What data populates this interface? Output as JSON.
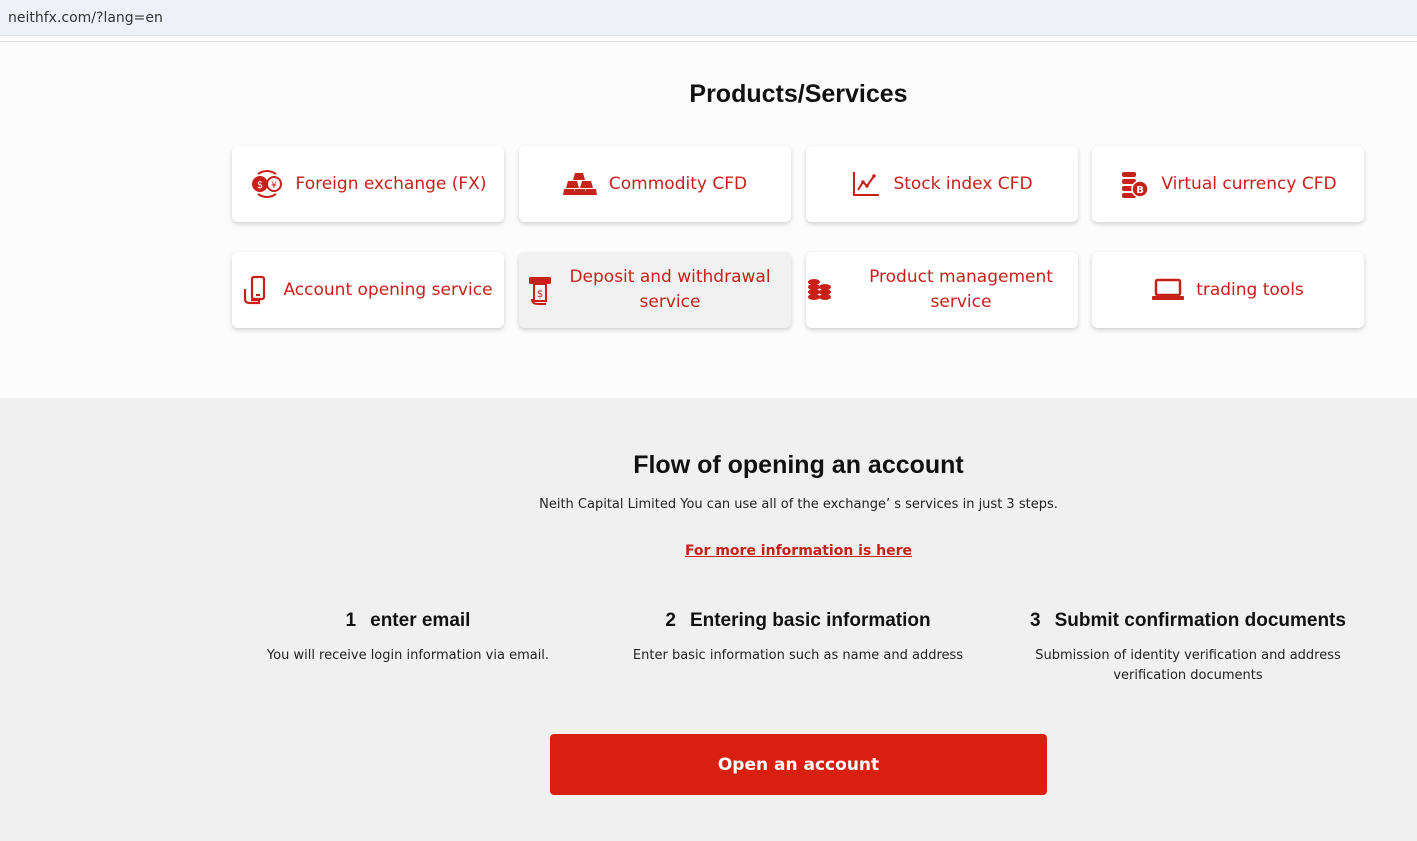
{
  "browser": {
    "url": "neithfx.com/?lang=en"
  },
  "products": {
    "title": "Products/Services",
    "cards": [
      {
        "label": "Foreign exchange (FX)",
        "icon": "currency-exchange-icon"
      },
      {
        "label": "Commodity CFD",
        "icon": "gold-bars-icon"
      },
      {
        "label": "Stock index CFD",
        "icon": "line-chart-icon"
      },
      {
        "label": "Virtual currency CFD",
        "icon": "bitcoin-coins-icon"
      },
      {
        "label": "Account opening service",
        "icon": "mobile-hand-icon"
      },
      {
        "label": "Deposit and withdrawal service",
        "icon": "atm-icon"
      },
      {
        "label": "Product management service",
        "icon": "coin-stack-icon"
      },
      {
        "label": "trading tools",
        "icon": "laptop-icon"
      }
    ]
  },
  "flow": {
    "title": "Flow of opening an account",
    "subtitle": "Neith Capital Limited You can use all of the exchange’ s services in just 3 steps.",
    "link": "For more information is here",
    "steps": [
      {
        "num": "1",
        "title": "enter email",
        "desc": "You will receive login information via email."
      },
      {
        "num": "2",
        "title": "Entering basic information",
        "desc": "Enter basic information such as name and address"
      },
      {
        "num": "3",
        "title": "Submit confirmation documents",
        "desc": "Submission of identity verification and address verification documents"
      }
    ],
    "button": "Open an account"
  },
  "colors": {
    "accent": "#c8211a",
    "button": "#d91f10",
    "flow_bg": "#f0f0f0"
  }
}
